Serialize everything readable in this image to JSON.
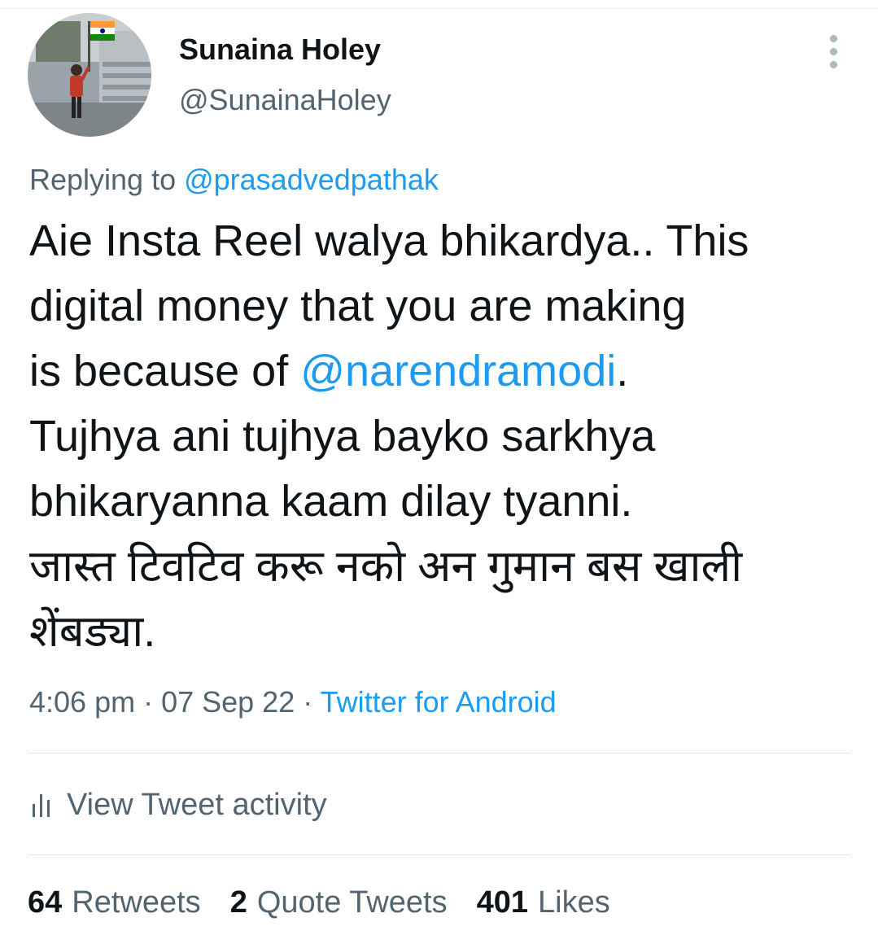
{
  "colors": {
    "link": "#1d9bf0",
    "text_primary": "#0f1419",
    "text_secondary": "#536471",
    "divider": "#e1e8ed"
  },
  "tweet": {
    "author": {
      "display_name": "Sunaina Holey",
      "handle": "@SunainaHoley"
    },
    "replying_prefix": "Replying to ",
    "replying_to": "@prasadvedpathak",
    "body": {
      "line1": "Aie Insta Reel walya bhikardya.. This",
      "line2": "digital money that you are making",
      "line3_before": "is because of ",
      "line3_mention": "@narendramodi",
      "line3_after": ".",
      "line4": "Tujhya ani tujhya bayko sarkhya",
      "line5": "bhikaryanna kaam dilay tyanni.",
      "line6": "जास्त टिवटिव करू नको अन गुमान बस खाली",
      "line7": "शेंबड्या."
    },
    "time": "4:06 pm",
    "separator": " · ",
    "date": "07 Sep 22",
    "source": "Twitter for Android"
  },
  "activity": {
    "icon": "bar-chart-icon",
    "label": "View Tweet activity"
  },
  "stats": {
    "retweets_count": "64",
    "retweets_label": "Retweets",
    "quotes_count": "2",
    "quotes_label": "Quote Tweets",
    "likes_count": "401",
    "likes_label": "Likes"
  },
  "icons": {
    "more": "more-vertical-icon",
    "avatar": "profile-photo"
  }
}
